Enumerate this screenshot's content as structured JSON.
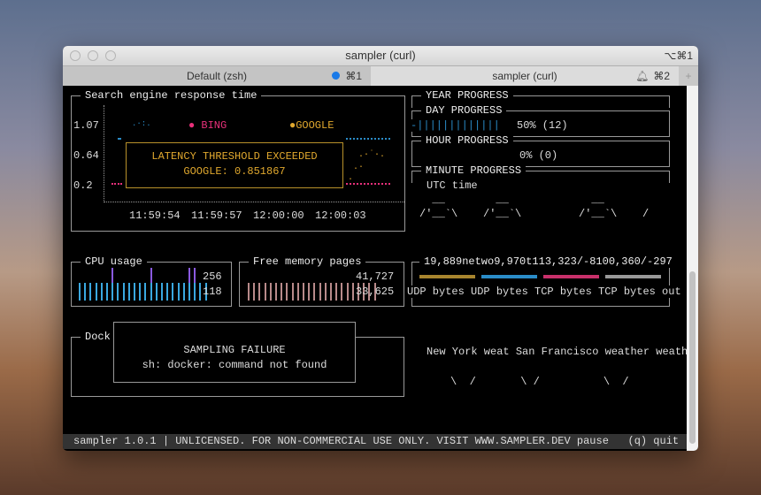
{
  "window": {
    "title": "sampler (curl)",
    "shortcut": "⌥⌘1"
  },
  "tabs": [
    {
      "label": "Default (zsh)",
      "key": "⌘1",
      "indicator": "blue-dot"
    },
    {
      "label": "sampler (curl)",
      "key": "⌘2",
      "indicator": "bell-icon",
      "active": true
    }
  ],
  "search": {
    "title": "Search engine response time",
    "y_ticks": [
      "1.07",
      "0.64",
      "0.2"
    ],
    "x_ticks": [
      "11:59:54",
      "11:59:57",
      "12:00:00",
      "12:00:03"
    ],
    "legend": [
      {
        "name": "BING",
        "color": "#e8307a"
      },
      {
        "name": "GOOGLE",
        "color": "#e0a82e"
      }
    ],
    "alert": {
      "title": "LATENCY THRESHOLD EXCEEDED",
      "message": "GOOGLE: 0.851867"
    }
  },
  "progress": {
    "year": "YEAR PROGRESS",
    "day": "DAY PROGRESS",
    "day_value": "50% (12)",
    "day_fraction": 0.5,
    "hour": "HOUR PROGRESS",
    "hour_value": "0% (0)",
    "hour_fraction": 0,
    "minute": "MINUTE PROGRESS"
  },
  "clock": {
    "label": "UTC time",
    "line1": "  __        __             __",
    "line2": "/'__`\\    /'__`\\         /'__`\\    /"
  },
  "cpu": {
    "title": "CPU usage",
    "max": "256",
    "cur": "118"
  },
  "memory": {
    "title": "Free memory pages",
    "max": "41,727",
    "cur": "33,625"
  },
  "network": {
    "title": "19,889netwo9,970t113,323/-8100,360/-297",
    "labels": "UDP bytes UDP bytes TCP bytes TCP bytes out",
    "colors": [
      "#a8852e",
      "#2a8cc8",
      "#c8306a",
      "#999999"
    ]
  },
  "docker": {
    "title": "Dock",
    "error_title": "SAMPLING FAILURE",
    "error_message": "sh: docker: command not found"
  },
  "weather": {
    "labels": "New York weat San Francisco weather weath",
    "art": "\\  /       \\ /          \\  /"
  },
  "status": {
    "text": "sampler 1.0.1 | UNLICENSED. FOR NON-COMMERCIAL USE ONLY. VISIT WWW.SAMPLER.DEV pause   (q) quit"
  }
}
